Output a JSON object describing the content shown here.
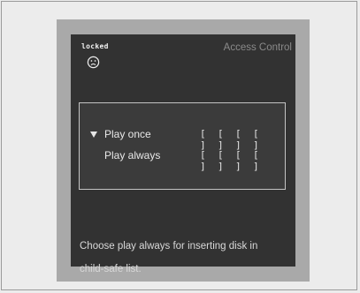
{
  "status": {
    "label": "locked",
    "icon": "sad-face-icon"
  },
  "screen": {
    "title": "Access Control"
  },
  "options": [
    {
      "label": "Play once",
      "selected": true,
      "digits": [
        "[ ]",
        "[ ]",
        "[ ]",
        "[ ]"
      ]
    },
    {
      "label": "Play always",
      "selected": false,
      "digits": [
        "[ ]",
        "[ ]",
        "[ ]",
        "[ ]"
      ]
    }
  ],
  "help": {
    "line1": "Choose play always for inserting disk in",
    "line2": "child-safe list."
  },
  "colors": {
    "screen_bg": "#323232",
    "frame": "#a9a9a9",
    "text": "#e6e6e6",
    "title": "#8a8a8a"
  }
}
